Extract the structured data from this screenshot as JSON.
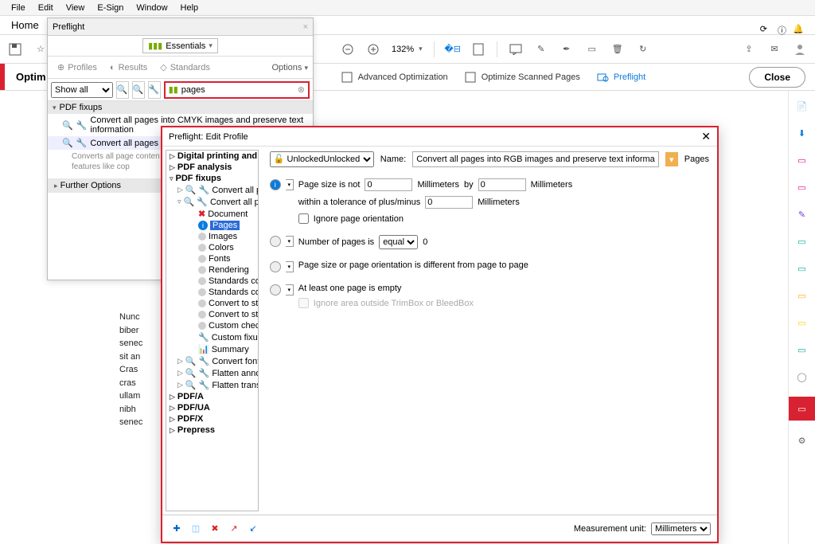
{
  "menu": {
    "file": "File",
    "edit": "Edit",
    "view": "View",
    "esign": "E-Sign",
    "window": "Window",
    "help": "Help"
  },
  "tabs": {
    "home": "Home"
  },
  "toolbar": {
    "zoom": "132%"
  },
  "optbar": {
    "title": "Optim",
    "adv": "Advanced Optimization",
    "scan": "Optimize Scanned Pages",
    "preflight": "Preflight",
    "close": "Close"
  },
  "doc": {
    "l1": "Nunc",
    "l2": "biber",
    "l3": "senec",
    "l4": "sit an",
    "l5": "Cras",
    "l6": "cras",
    "l7": "ullam",
    "l8": "nibh",
    "l9": "senec"
  },
  "preflight": {
    "title": "Preflight",
    "lib": "Essentials",
    "tabs": {
      "profiles": "Profiles",
      "results": "Results",
      "standards": "Standards",
      "options": "Options"
    },
    "showall": "Show all",
    "search": "pages",
    "group": "PDF fixups",
    "item1": "Convert all pages into CMYK images and preserve text information",
    "item2": "Convert all pages into RG",
    "desc": "Converts all page conten\nquality) and creates an in\npreserve features like cop",
    "further": "Further Options"
  },
  "edit": {
    "title": "Preflight: Edit Profile",
    "tree": {
      "n1": "Digital printing and online publishing",
      "n2": "PDF analysis",
      "n3": "PDF fixups",
      "n3a": "Convert all pages into CMYK images",
      "n3b": "Convert all pages into RGB images a",
      "d": "Document",
      "p": "Pages",
      "im": "Images",
      "co": "Colors",
      "fo": "Fonts",
      "re": "Rendering",
      "sc": "Standards compliance",
      "sce": "Standards compliance for embedde",
      "cs": "Convert to standard",
      "cse": "Convert to standard for embedded",
      "cc": "Custom checks",
      "cf": "Custom fixups",
      "su": "Summary",
      "cfo": "Convert fonts to outlines",
      "fa": "Flatten annotations and form fields",
      "ft": "Flatten transparency (high resolutio",
      "pa": "PDF/A",
      "pua": "PDF/UA",
      "px": "PDF/X",
      "pp": "Prepress"
    },
    "unlocked": "Unlocked",
    "namelbl": "Name:",
    "nameval": "Convert all pages into RGB images and preserve text informa",
    "pages": "Pages",
    "c1": {
      "label": "Page size is not",
      "v1": "0",
      "u1": "Millimeters",
      "by": "by",
      "v2": "0",
      "u2": "Millimeters",
      "tol": "within a tolerance of plus/minus",
      "tv": "0",
      "tu": "Millimeters",
      "ign": "Ignore page orientation"
    },
    "c2": {
      "label": "Number of pages is",
      "op": "equal",
      "v": "0"
    },
    "c3": "Page size or page orientation is different from page to page",
    "c4": {
      "label": "At least one page is empty",
      "ign": "Ignore area outside TrimBox or BleedBox"
    },
    "mu": {
      "label": "Measurement unit:",
      "val": "Millimeters"
    }
  }
}
